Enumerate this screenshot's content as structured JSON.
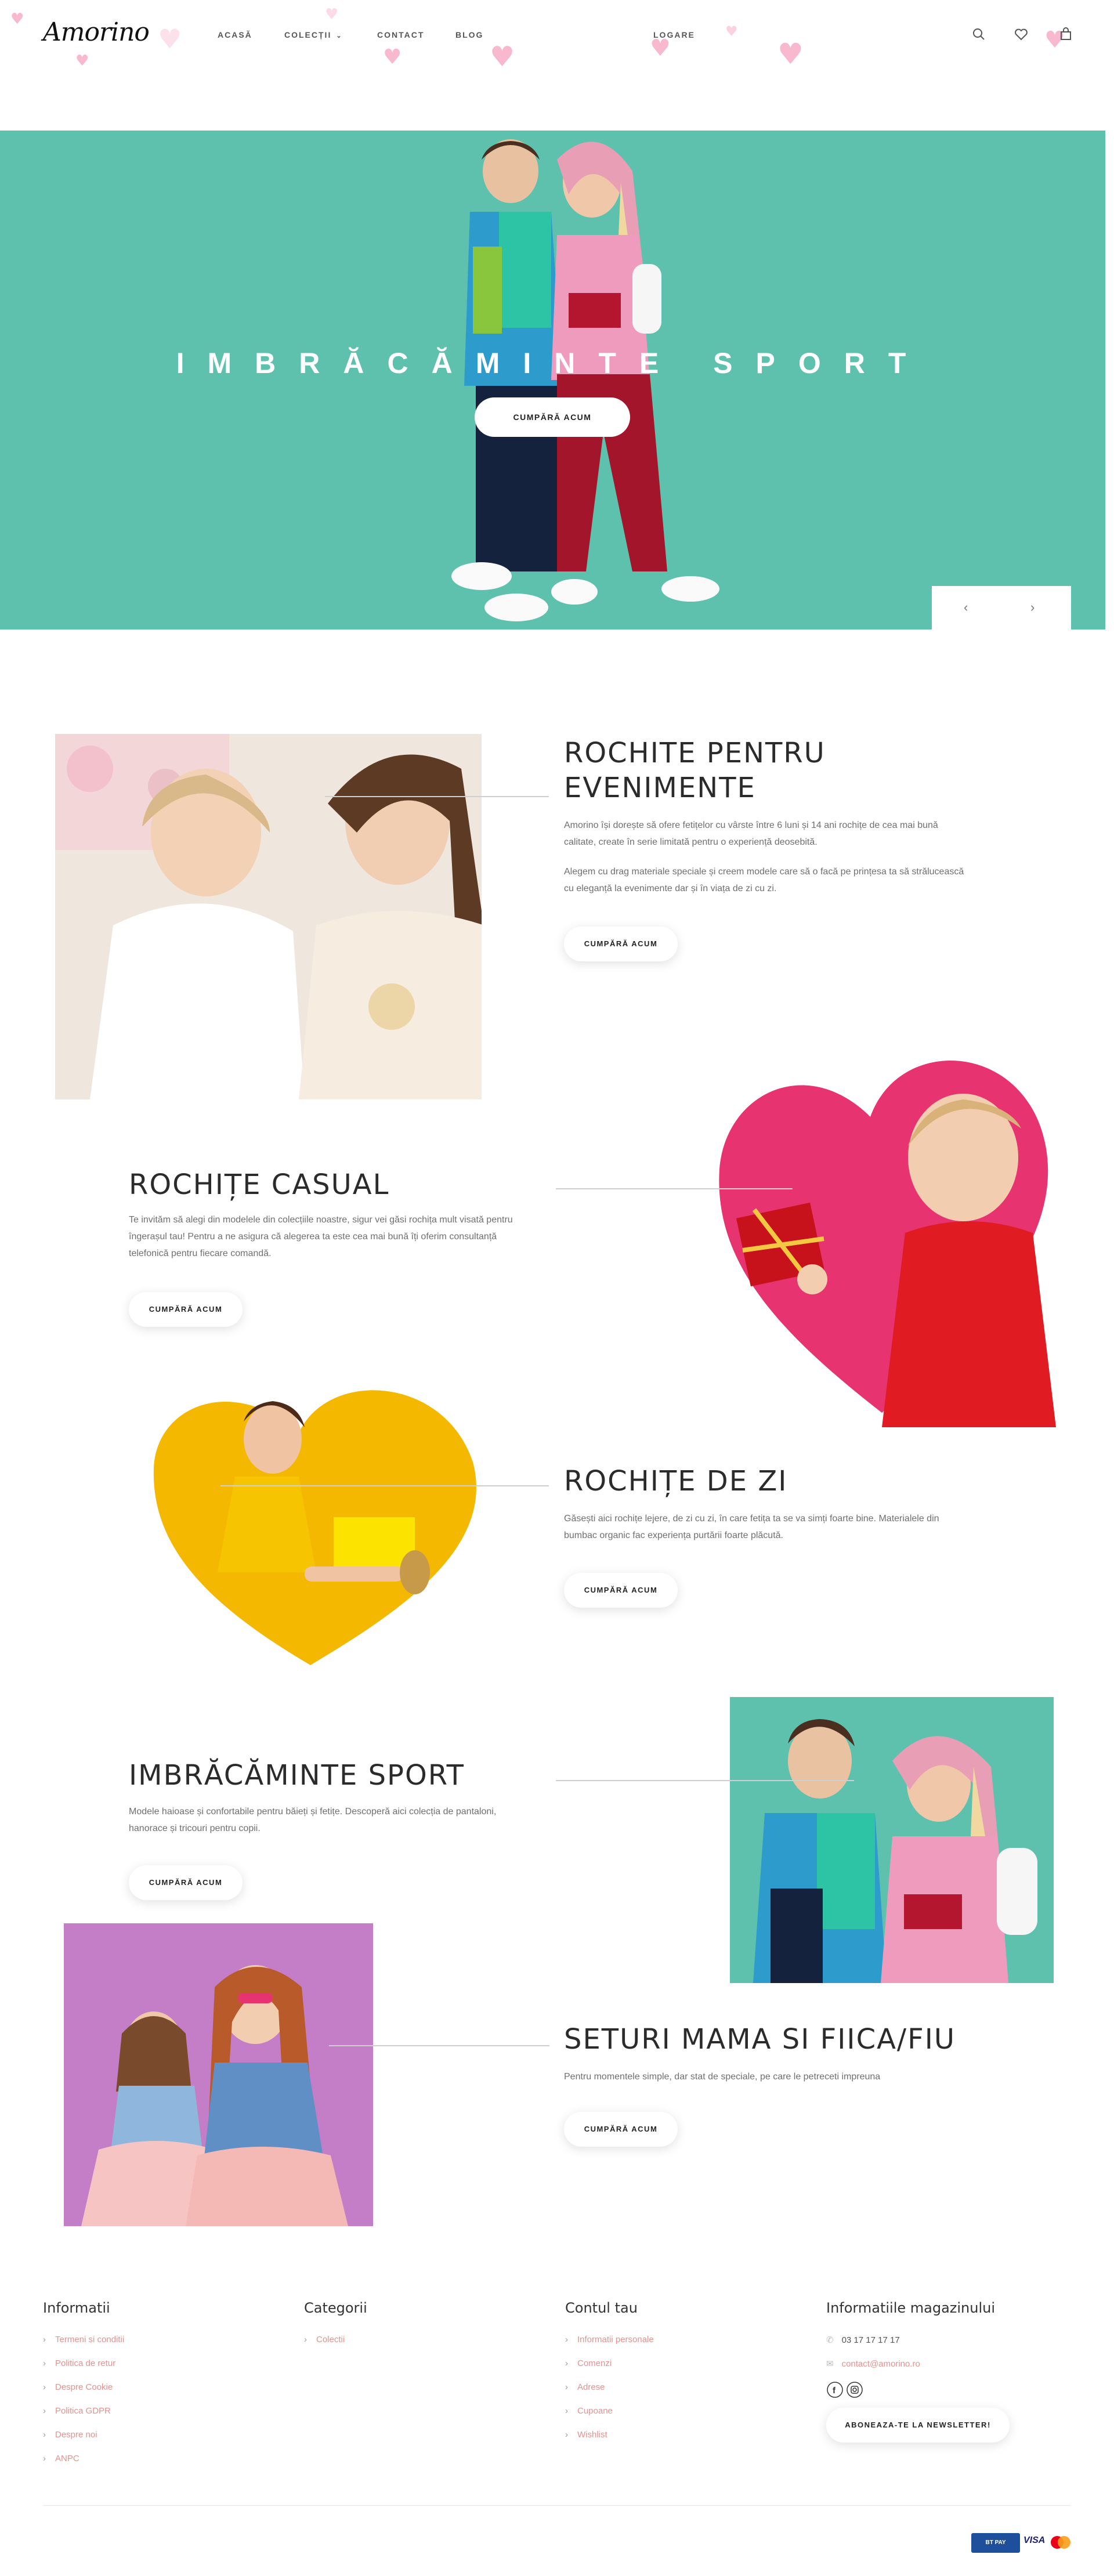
{
  "header": {
    "logo": "Amorino",
    "nav": [
      "ACASĂ",
      "COLECȚII",
      "CONTACT",
      "BLOG"
    ],
    "login": "LOGARE",
    "icons": [
      "search-icon",
      "heart-icon",
      "cart-icon"
    ]
  },
  "hero": {
    "title": "IMBRĂCĂMINTE SPORT",
    "button": "CUMPĂRĂ ACUM",
    "prev": "‹",
    "next": "›"
  },
  "sections": [
    {
      "title": "ROCHITE PENTRU EVENIMENTE",
      "text1": "Amorino își dorește să ofere fetițelor cu vârste între 6 luni și 14 ani rochițe de cea mai bună calitate, create în serie limitată pentru o experiență deosebită.",
      "text2": "Alegem cu drag materiale speciale și creem modele care să o facă pe prințesa ta să strălucească cu eleganță la evenimente dar și în viața de zi cu zi.",
      "button": "CUMPĂRĂ ACUM"
    },
    {
      "title": "ROCHIȚE CASUAL",
      "text1": "Te invităm să alegi din modelele din colecțiile noastre, sigur vei găsi rochița mult visată pentru îngerașul tau! Pentru a ne asigura că alegerea ta este cea mai bună îți oferim consultanță telefonică pentru fiecare comandă.",
      "button": "CUMPĂRĂ ACUM"
    },
    {
      "title": "ROCHIȚE DE ZI",
      "text1": "Găsești aici rochițe lejere, de zi cu zi, în care fetița ta se va simți foarte bine. Materialele din bumbac organic fac experiența purtării foarte plăcută.",
      "button": "CUMPĂRĂ ACUM"
    },
    {
      "title": "IMBRĂCĂMINTE SPORT",
      "text1": "Modele haioase și confortabile pentru băieți și fetițe. Descoperă aici colecția de pantaloni, hanorace și tricouri pentru copii.",
      "button": "CUMPĂRĂ ACUM"
    },
    {
      "title": "SETURI MAMA SI FIICA/FIU",
      "text1": "Pentru momentele simple, dar stat de speciale, pe care le petreceti impreuna",
      "button": "CUMPĂRĂ ACUM"
    }
  ],
  "footer": {
    "col1": {
      "title": "Informatii",
      "links": [
        "Termeni si conditii",
        "Politica de retur",
        "Despre Cookie",
        "Politica GDPR",
        "Despre noi",
        "ANPC"
      ]
    },
    "col2": {
      "title": "Categorii",
      "links": [
        "Colectii"
      ]
    },
    "col3": {
      "title": "Contul tau",
      "links": [
        "Informatii personale",
        "Comenzi",
        "Adrese",
        "Cupoane",
        "Wishlist"
      ]
    },
    "col4": {
      "title": "Informatiile magazinului",
      "phone": "03 17 17 17 17",
      "email": "contact@amorino.ro",
      "newsletter": "ABONEAZA-TE LA NEWSLETTER!"
    },
    "payments": [
      "BT PAY",
      "VISA",
      "mastercard"
    ]
  },
  "colors": {
    "teal": "#5dc1ad",
    "pink_link": "#e3928f",
    "purple": "#c47ec7",
    "yellow": "#f5b800",
    "heart_pink": "#e7336f"
  }
}
